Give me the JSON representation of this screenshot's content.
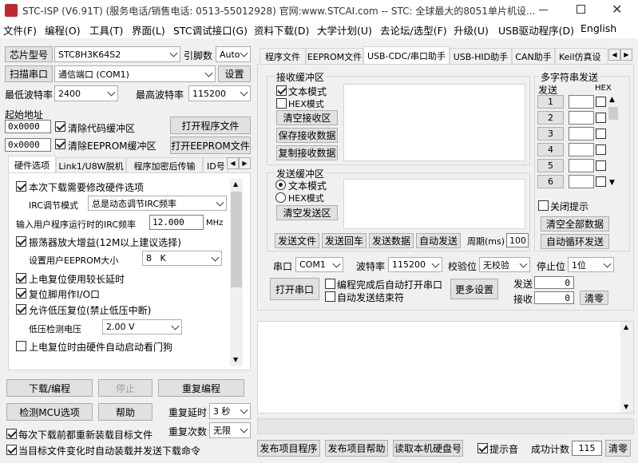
{
  "window": {
    "title": "STC-ISP (V6.91T) (服务电话/销售电话: 0513-55012928) 官网:www.STCAI.com  -- STC: 全球最大的8051单片机设..."
  },
  "menu": [
    "文件(F)",
    "编程(O)",
    "工具(T)",
    "界面(L)",
    "STC调试接口(G)",
    "资料下载(D)",
    "大学计划(U)",
    "去论坛/选型(F)",
    "升级(U)",
    "USB驱动程序(D)",
    "English"
  ],
  "left": {
    "chip_label": "芯片型号",
    "chip_value": "STC8H3K64S2",
    "pin_label": "引脚数",
    "pin_value": "Auto",
    "scan_btn": "扫描串口",
    "port_value": "通信端口 (COM1)",
    "settings_btn": "设置",
    "minbaud_label": "最低波特率",
    "minbaud_value": "2400",
    "maxbaud_label": "最高波特率",
    "maxbaud_value": "115200",
    "start_addr_label": "起始地址",
    "addr1": "0x0000",
    "clear_code": "清除代码缓冲区",
    "open_prog": "打开程序文件",
    "addr2": "0x0000",
    "clear_eeprom": "清除EEPROM缓冲区",
    "open_eeprom": "打开EEPROM文件"
  },
  "hwtabs": [
    "硬件选项",
    "Link1/U8W脱机",
    "程序加密后传输",
    "ID号"
  ],
  "hw": {
    "opt1": "本次下载需要修改硬件选项",
    "irc_mode_label": "IRC调节模式",
    "irc_mode_value": "总是动态调节IRC频率",
    "freq_label": "输入用户程序运行时的IRC频率",
    "freq_value": "12.000",
    "freq_unit": "MHz",
    "opt2": "振荡器放大增益(12M以上建议选择)",
    "eeprom_size_label": "设置用户EEPROM大小",
    "eeprom_size_value": "8   K",
    "opt3": "上电复位使用较长延时",
    "opt4": "复位脚用作I/O口",
    "opt5": "允许低压复位(禁止低压中断)",
    "lvd_label": "低压检测电压",
    "lvd_value": "2.00 V",
    "opt6": "上电复位时由硬件自动启动看门狗"
  },
  "bottom_left": {
    "download": "下载/编程",
    "stop": "停止",
    "reprogram": "重复编程",
    "detect": "检测MCU选项",
    "help": "帮助",
    "delay_label": "重复延时",
    "delay_value": "3 秒",
    "reload": "每次下载前都重新装载目标文件",
    "count_label": "重复次数",
    "count_value": "无限",
    "auto_load": "当目标文件变化时自动装载并发送下载命令"
  },
  "tabs": [
    "程序文件",
    "EEPROM文件",
    "USB-CDC/串口助手",
    "USB-HID助手",
    "CAN助手",
    "Keil仿真设"
  ],
  "rx": {
    "title": "接收缓冲区",
    "text_mode": "文本模式",
    "hex_mode": "HEX模式",
    "clear": "清空接收区",
    "save": "保存接收数据",
    "copy": "复制接收数据"
  },
  "tx": {
    "title": "发送缓冲区",
    "text_mode": "文本模式",
    "hex_mode": "HEX模式",
    "clear": "清空发送区",
    "send_file": "发送文件",
    "send_enter": "发送回车",
    "send_data": "发送数据",
    "auto_send": "自动发送",
    "period_label": "周期(ms)",
    "period_value": "100"
  },
  "multi": {
    "title": "多字符串发送",
    "send_col": "发送",
    "hex_col": "HEX",
    "rows": [
      "1",
      "2",
      "3",
      "4",
      "5",
      "6"
    ],
    "close_hint": "关闭提示",
    "clear_all": "清空全部数据",
    "auto_loop": "自动循环发送"
  },
  "serial": {
    "port_label": "串口",
    "port_value": "COM1",
    "baud_label": "波特率",
    "baud_value": "115200",
    "parity_label": "校验位",
    "parity_value": "无校验",
    "stop_label": "停止位",
    "stop_value": "1位",
    "open_btn": "打开串口",
    "auto_open": "编程完成后自动打开串口",
    "auto_end": "自动发送结束符",
    "more": "更多设置",
    "sent_label": "发送",
    "sent_value": "0",
    "recv_label": "接收",
    "recv_value": "0",
    "clear": "清零"
  },
  "footer": {
    "publish_prog": "发布项目程序",
    "publish_help": "发布项目帮助",
    "read_disk": "读取本机硬盘号",
    "sound": "提示音",
    "success_label": "成功计数",
    "success_value": "115",
    "clear": "清零"
  }
}
